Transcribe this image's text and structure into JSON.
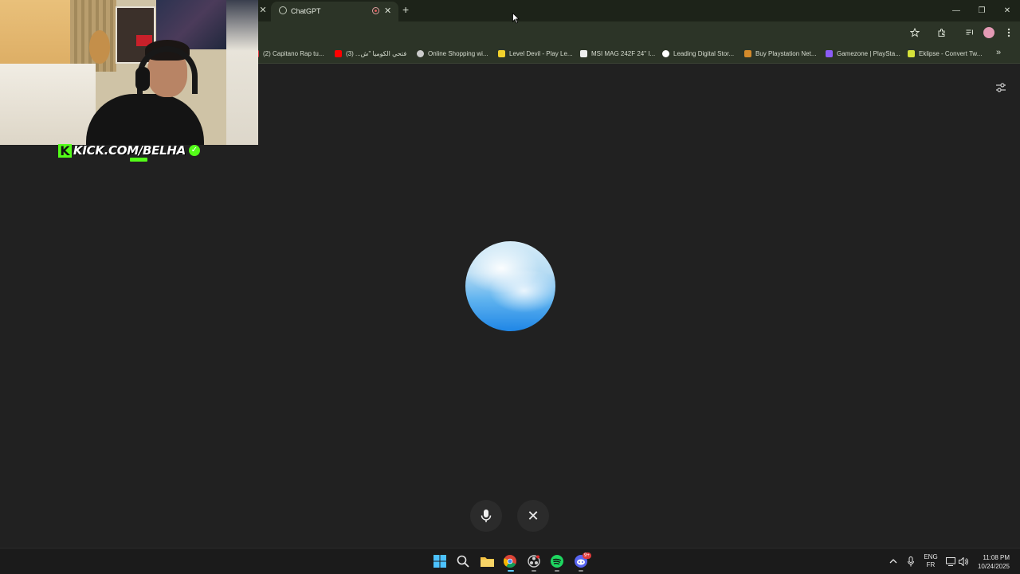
{
  "browser": {
    "active_tab_title": "ChatGPT",
    "new_tab_symbol": "+",
    "close_symbol": "✕",
    "window_controls": [
      "—",
      "❐",
      "✕"
    ],
    "bookmarks": [
      {
        "label": "(2) Capitano Rap tu...",
        "icon_color": "#d9313a"
      },
      {
        "label": "فتحي الكوميا \"ش... (3)",
        "icon_color": "#ff0000"
      },
      {
        "label": "Online Shopping wi...",
        "icon_color": "#cccccc"
      },
      {
        "label": "Level Devil - Play Le...",
        "icon_color": "#f2d12c"
      },
      {
        "label": "MSI MAG 242F 24\" I...",
        "icon_color": "#eeeeee"
      },
      {
        "label": "Leading Digital Stor...",
        "icon_color": "#ffffff"
      },
      {
        "label": "Buy Playstation Net...",
        "icon_color": "#d38a2b"
      },
      {
        "label": "Gamezone | PlaySta...",
        "icon_color": "#8b5cf6"
      },
      {
        "label": "Eklipse - Convert Tw...",
        "icon_color": "#d6e23a"
      }
    ],
    "bookmarks_overflow": "»"
  },
  "overlay": {
    "channel": "KICK.COM/BELHA",
    "brand_color": "#53fc18"
  },
  "voice": {
    "orb_colors": [
      "#d6ecf8",
      "#5fb3ef",
      "#1f86e6"
    ],
    "mic_button": "mic-icon",
    "close_button": "✕"
  },
  "taskbar": {
    "language_top": "ENG",
    "language_bottom": "FR",
    "time": "11:08 PM",
    "date": "10/24/2025",
    "discord_badge": "9+"
  }
}
